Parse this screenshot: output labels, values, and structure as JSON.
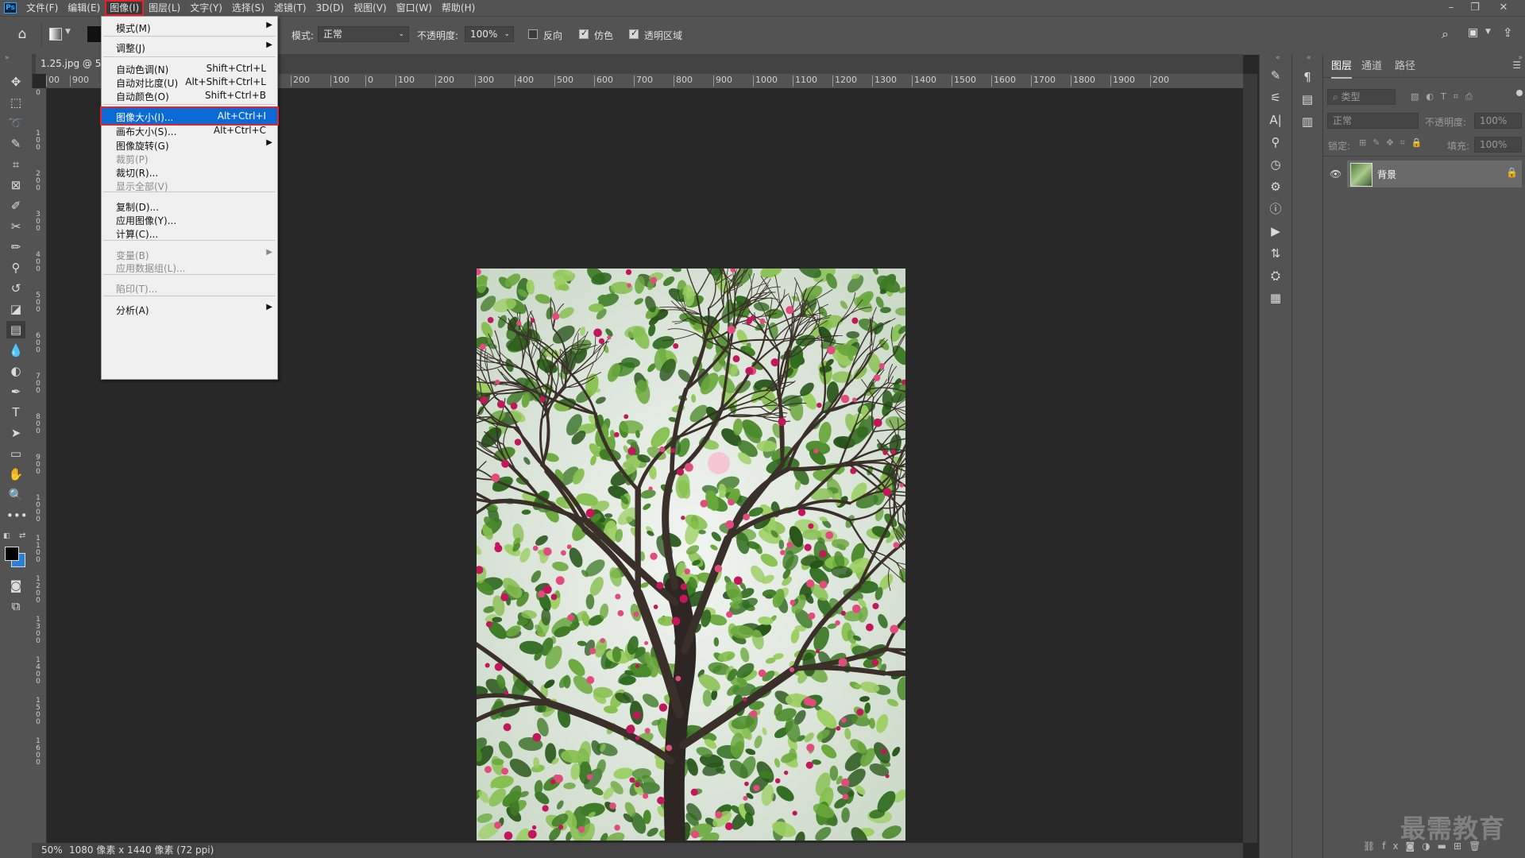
{
  "menubar": {
    "items": [
      "文件(F)",
      "编辑(E)",
      "图像(I)",
      "图层(L)",
      "文字(Y)",
      "选择(S)",
      "滤镜(T)",
      "3D(D)",
      "视图(V)",
      "窗口(W)",
      "帮助(H)"
    ]
  },
  "options": {
    "mode_label": "模式:",
    "mode_value": "正常",
    "opacity_label": "不透明度:",
    "opacity_value": "100%",
    "reverse_label": "反向",
    "dither_label": "仿色",
    "transparency_label": "透明区域"
  },
  "document": {
    "tab_title": "1.25.jpg @ 50",
    "zoom": "50%",
    "info": "1080 像素 x 1440 像素 (72 ppi)"
  },
  "ruler": {
    "h_labels": [
      "00",
      "900",
      "300",
      "200",
      "100",
      "0",
      "100",
      "200",
      "300",
      "400",
      "500",
      "600",
      "700",
      "800",
      "900",
      "1000",
      "1100",
      "1200",
      "1300",
      "1400",
      "1500",
      "1600",
      "1700",
      "1800",
      "1900",
      "200"
    ],
    "v_labels": [
      "0",
      "1 0 0",
      "2 0 0",
      "3 0 0",
      "4 0 0",
      "5 0 0",
      "6 0 0",
      "7 0 0",
      "8 0 0",
      "9 0 0",
      "1 0 0 0",
      "1 1 0 0",
      "1 2 0 0",
      "1 3 0 0",
      "1 4 0 0",
      "1 5 0 0",
      "1 6 0 0"
    ]
  },
  "image_menu": {
    "items": [
      {
        "label": "模式(M)",
        "shortcut": "",
        "submenu": true,
        "disabled": false
      },
      {
        "label": "调整(J)",
        "shortcut": "",
        "submenu": true,
        "disabled": false
      },
      {
        "label": "自动色调(N)",
        "shortcut": "Shift+Ctrl+L",
        "submenu": false,
        "disabled": false
      },
      {
        "label": "自动对比度(U)",
        "shortcut": "Alt+Shift+Ctrl+L",
        "submenu": false,
        "disabled": false
      },
      {
        "label": "自动颜色(O)",
        "shortcut": "Shift+Ctrl+B",
        "submenu": false,
        "disabled": false
      },
      {
        "label": "图像大小(I)...",
        "shortcut": "Alt+Ctrl+I",
        "submenu": false,
        "disabled": false,
        "highlighted": true
      },
      {
        "label": "画布大小(S)...",
        "shortcut": "Alt+Ctrl+C",
        "submenu": false,
        "disabled": false
      },
      {
        "label": "图像旋转(G)",
        "shortcut": "",
        "submenu": true,
        "disabled": false
      },
      {
        "label": "裁剪(P)",
        "shortcut": "",
        "submenu": false,
        "disabled": true
      },
      {
        "label": "裁切(R)...",
        "shortcut": "",
        "submenu": false,
        "disabled": false
      },
      {
        "label": "显示全部(V)",
        "shortcut": "",
        "submenu": false,
        "disabled": true
      },
      {
        "label": "复制(D)...",
        "shortcut": "",
        "submenu": false,
        "disabled": false
      },
      {
        "label": "应用图像(Y)...",
        "shortcut": "",
        "submenu": false,
        "disabled": false
      },
      {
        "label": "计算(C)...",
        "shortcut": "",
        "submenu": false,
        "disabled": false
      },
      {
        "label": "变量(B)",
        "shortcut": "",
        "submenu": true,
        "disabled": true
      },
      {
        "label": "应用数据组(L)...",
        "shortcut": "",
        "submenu": false,
        "disabled": true
      },
      {
        "label": "陷印(T)...",
        "shortcut": "",
        "submenu": false,
        "disabled": true
      },
      {
        "label": "分析(A)",
        "shortcut": "",
        "submenu": true,
        "disabled": false
      }
    ]
  },
  "layers_panel": {
    "tabs": [
      "图层",
      "通道",
      "路径"
    ],
    "filter_placeholder": "类型",
    "blend_mode": "正常",
    "opacity_label": "不透明度:",
    "opacity_value": "100%",
    "lock_label": "锁定:",
    "fill_label": "填充:",
    "fill_value": "100%",
    "layer_name": "背景"
  },
  "watermark": "最需教育",
  "colors": {
    "accent": "#0a6bd7",
    "highlight_box": "#e5212a",
    "panel_bg": "#535353",
    "canvas_bg": "#282828"
  }
}
